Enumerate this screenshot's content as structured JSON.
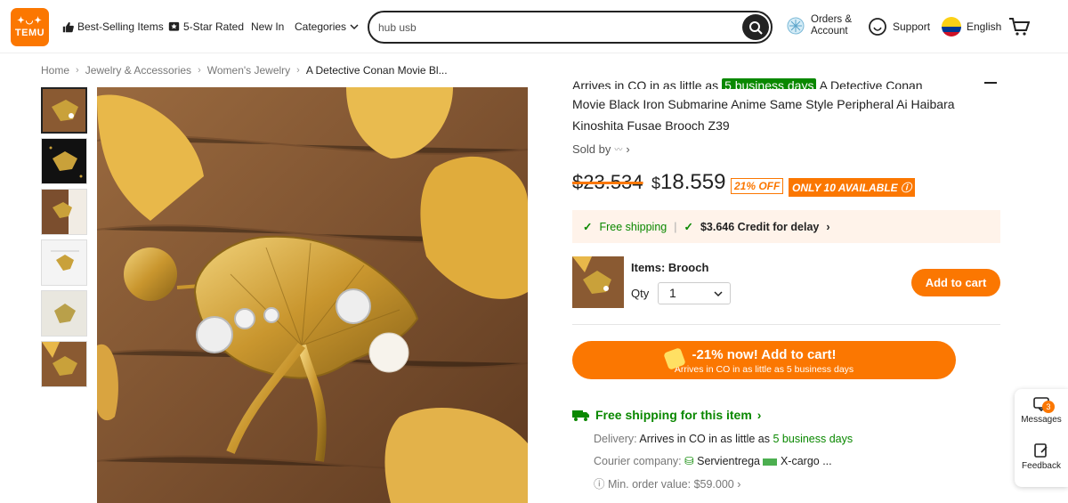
{
  "header": {
    "logo_text": "TEMU",
    "nav": [
      "Best-Selling Items",
      "5-Star Rated",
      "New In",
      "Categories"
    ],
    "search_value": "hub usb",
    "orders_line1": "Orders &",
    "orders_line2": "Account",
    "support": "Support",
    "language": "English",
    "accent_color": "#fb7701"
  },
  "breadcrumb": [
    "Home",
    "Jewelry & Accessories",
    "Women's Jewelry",
    "A Detective Conan Movie Bl..."
  ],
  "product": {
    "arrives_prefix": "Arrives in CO in as little as",
    "arrives_badge": "5 business days",
    "title_start": "A Detective Conan",
    "title_line2": "Movie Black Iron Submarine Anime Same Style Peripheral Ai Haibara",
    "title_line3": "Kinoshita Fusae Brooch Z39",
    "sold_by": "Sold by",
    "price_old": "$23.534",
    "price_currency": "$",
    "price_new": "18.559",
    "off": "21% OFF",
    "availability": "ONLY 10 AVAILABLE",
    "free_shipping": "Free shipping",
    "credit": "$3.646 Credit for delay",
    "items_label": "Items: Brooch",
    "qty_label": "Qty",
    "qty_value": "1",
    "add_to_cart": "Add to cart",
    "big_btn_line1": "-21% now! Add to cart!",
    "big_btn_line2": "Arrives in CO in as little as 5 business days",
    "free_ship_heading": "Free shipping for this item",
    "delivery_label": "Delivery:",
    "delivery_value": "Arrives in CO in as little as",
    "delivery_days": "5 business days",
    "courier_label": "Courier company:",
    "courier_1": "Servientrega",
    "courier_2": "X-cargo ...",
    "min_order": "Min. order value: $59.000"
  },
  "side_panel": {
    "messages": "Messages",
    "messages_count": "3",
    "feedback": "Feedback"
  }
}
